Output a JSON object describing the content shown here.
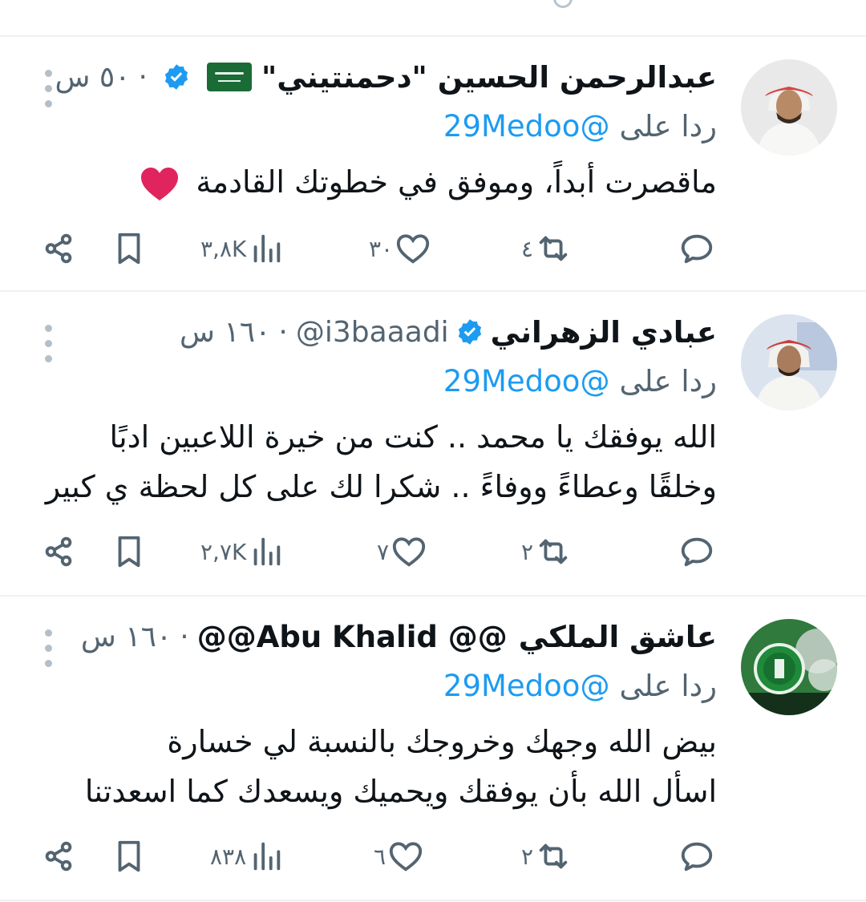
{
  "tweets": [
    {
      "display_name": "عبدالرحمن الحسين \"دحمنتيني\"",
      "flag": "saudi-flag",
      "verified": true,
      "handle": "",
      "separator": "·",
      "time": "٥٠ س",
      "reply_prefix": "ردا على",
      "reply_to": "@29Medoo",
      "text_lines": [
        "ماقصرت أبداً، وموفق في خطوتك القادمة"
      ],
      "emoji": "red-heart",
      "stats": {
        "replies": "",
        "retweets": "٤",
        "likes": "٣٠",
        "views": "٣,٨K"
      }
    },
    {
      "display_name": "عبادي الزهراني",
      "verified": true,
      "handle": "@i3baaadi",
      "separator": "·",
      "time": "١٦٠ س",
      "reply_prefix": "ردا على",
      "reply_to": "@29Medoo",
      "text_lines": [
        "الله يوفقك يا محمد .. كنت من خيرة اللاعبين ادبًا",
        "وخلقًا وعطاءً ووفاءً .. شكرا لك على كل لحظة ي كبير"
      ],
      "stats": {
        "replies": "",
        "retweets": "٢",
        "likes": "٧",
        "views": "٢,٧K"
      }
    },
    {
      "display_name": "عاشق الملكي",
      "handle": "@@Abu Khalid @@",
      "verified": false,
      "separator": "·",
      "time": "١٦٠ س",
      "reply_prefix": "ردا على",
      "reply_to": "@29Medoo",
      "text_lines": [
        "بيض الله وجهك وخروجك بالنسبة لي خسارة",
        "اسأل الله بأن يوفقك ويحميك ويسعدك كما اسعدتنا"
      ],
      "stats": {
        "replies": "",
        "retweets": "٢",
        "likes": "٦",
        "views": "٨٣٨"
      }
    }
  ],
  "colors": {
    "text": "#0f1419",
    "secondary": "#536471",
    "link": "#1d9bf0",
    "verified": "#1d9bf0",
    "divider": "#eef1f4",
    "heart": "#e0245e"
  },
  "icons": [
    "reply-icon",
    "retweet-icon",
    "like-icon",
    "views-icon",
    "bookmark-icon",
    "share-icon",
    "more-options-icon",
    "verified-badge-icon"
  ]
}
